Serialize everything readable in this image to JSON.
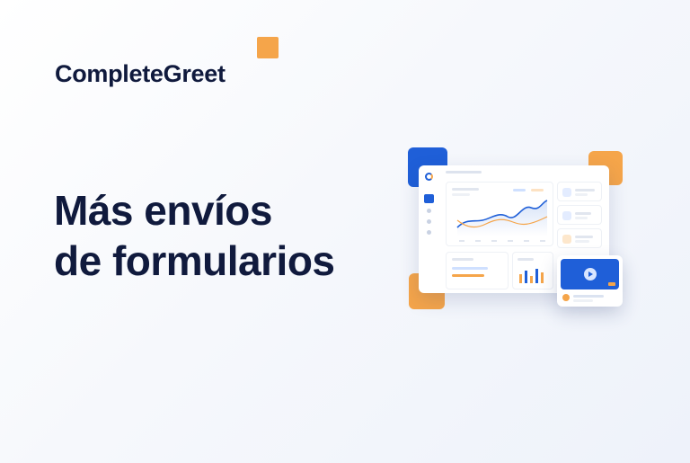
{
  "brand": {
    "name": "CompleteGreet"
  },
  "headline": {
    "line1": "Más envíos",
    "line2": "de formularios"
  },
  "colors": {
    "primary": "#1f5fd8",
    "accent": "#f5a54a",
    "text": "#101a3d"
  },
  "illustration": {
    "type": "dashboard-mockup",
    "icons": [
      "logo-icon",
      "nav-icon",
      "trend-icon",
      "bar-chart-icon",
      "document-icon",
      "play-icon"
    ]
  }
}
